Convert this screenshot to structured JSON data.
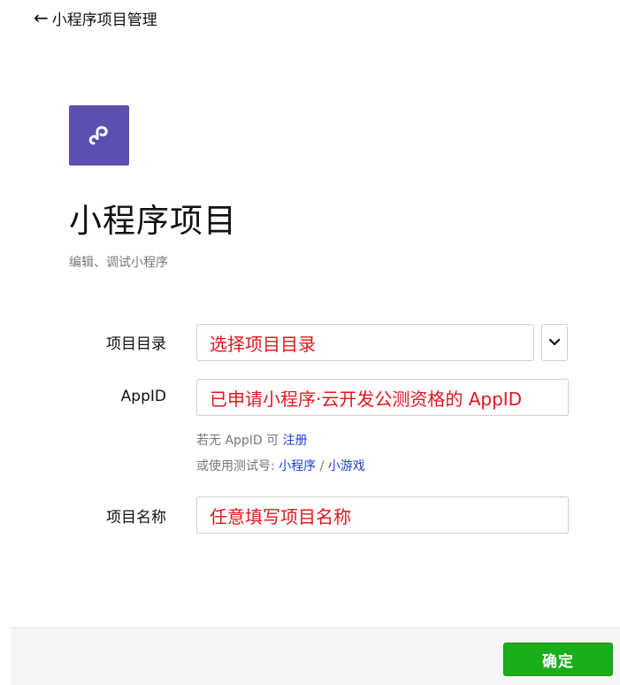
{
  "header": {
    "back_label": "小程序项目管理"
  },
  "project_type": {
    "title": "小程序项目",
    "subtitle": "编辑、调试小程序",
    "icon": "mini-program-logo-icon",
    "accent": "#5b4fb0"
  },
  "form": {
    "directory": {
      "label": "项目目录",
      "value": "选择项目目录"
    },
    "appid": {
      "label": "AppID",
      "value": "已申请小程序·云开发公测资格的 AppID"
    },
    "appid_hint": {
      "prefix": "若无 AppID 可 ",
      "register_link": "注册",
      "test_prefix": "或使用测试号: ",
      "mini_program_link": "小程序",
      "separator": " / ",
      "mini_game_link": "小游戏"
    },
    "project_name": {
      "label": "项目名称",
      "value": "任意填写项目名称"
    }
  },
  "footer": {
    "confirm_label": "确定"
  },
  "colors": {
    "confirm_button": "#1aad19",
    "annotation_text": "#e0181e",
    "link": "#1a3fd6"
  }
}
